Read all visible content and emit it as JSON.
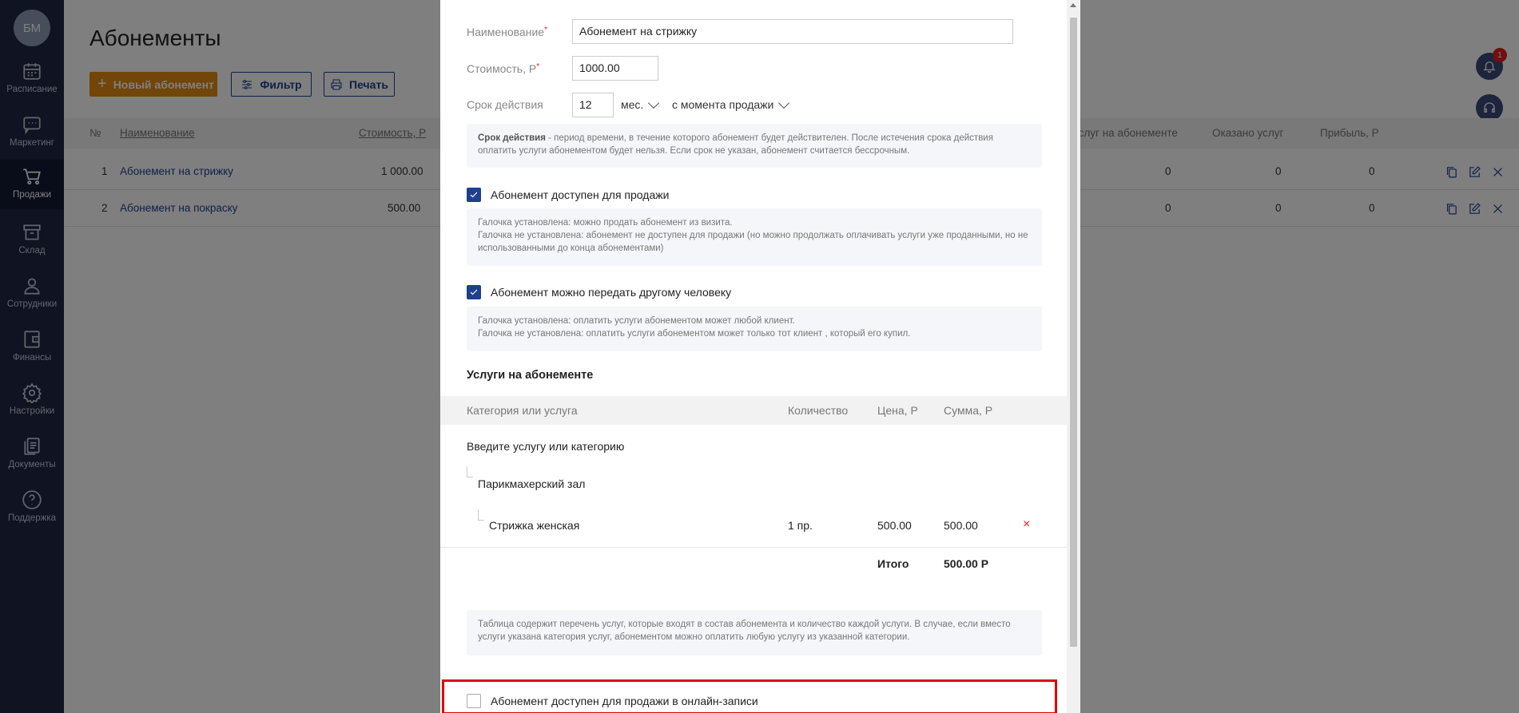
{
  "sidebar": {
    "avatar": "БМ",
    "items": [
      {
        "label": "Расписание",
        "icon": "calendar-icon"
      },
      {
        "label": "Маркетинг",
        "icon": "chat-icon"
      },
      {
        "label": "Продажи",
        "icon": "cart-icon"
      },
      {
        "label": "Склад",
        "icon": "box-icon"
      },
      {
        "label": "Сотрудники",
        "icon": "user-icon"
      },
      {
        "label": "Финансы",
        "icon": "wallet-icon"
      },
      {
        "label": "Настройки",
        "icon": "gear-icon"
      },
      {
        "label": "Документы",
        "icon": "documents-icon"
      },
      {
        "label": "Поддержка",
        "icon": "help-icon"
      }
    ],
    "active": "Продажи"
  },
  "page": {
    "title": "Абонементы",
    "new_button": "Новый абонемент",
    "filter_button": "Фильтр",
    "print_button": "Печать",
    "notification_count": "1"
  },
  "table": {
    "columns": [
      "№",
      "Наименование",
      "Стоимость, Р",
      "Услуг на абонементе",
      "Оказано услуг",
      "Прибыль, Р"
    ],
    "rows": [
      {
        "n": "1",
        "name": "Абонемент на стрижку",
        "price": "1 000.00",
        "services": "0",
        "done": "0",
        "profit": "0"
      },
      {
        "n": "2",
        "name": "Абонемент на покраску",
        "price": "500.00",
        "services": "0",
        "done": "0",
        "profit": "0"
      }
    ]
  },
  "modal": {
    "name_label": "Наименование",
    "name_value": "Абонемент на стрижку",
    "price_label": "Стоимость, Р",
    "price_value": "1000.00",
    "term_label": "Срок действия",
    "term_value": "12",
    "term_unit": "мес.",
    "term_start": "с момента продажи",
    "term_info_bold": "Срок действия",
    "term_info_text": " - период времени, в течение которого абонемент будет действителен. После истечения срока действия оплатить услуги абонементом будет нельзя. Если срок не указан, абонемент считается бессрочным.",
    "sale_checkbox": "Абонемент доступен для продажи",
    "sale_info_1": "Галочка установлена: можно продать абонемент из визита.",
    "sale_info_2": "Галочка не установлена: абонемент не доступен для продажи (но можно продолжать оплачивать услуги уже проданными, но не использованными до конца абонементами)",
    "transfer_checkbox": "Абонемент можно передать другому человеку",
    "transfer_info_1": "Галочка установлена: оплатить услуги абонементом может любой клиент.",
    "transfer_info_2": "Галочка не установлена: оплатить услуги абонементом может только тот клиент , который его купил.",
    "services_title": "Услуги на абонементе",
    "services_columns": [
      "Категория или услуга",
      "Количество",
      "Цена, Р",
      "Сумма, Р"
    ],
    "services_input_placeholder": "Введите услугу или категорию",
    "category": "Парикмахерский зал",
    "service": {
      "name": "Стрижка женская",
      "qty": "1 пр.",
      "price": "500.00",
      "sum": "500.00"
    },
    "total_label": "Итого",
    "total_value": "500.00 Р",
    "services_info": "Таблица содержит перечень услуг, которые входят в состав абонемента и количество каждой услуги. В случае, если вместо услуги указана категория услуг, абонементом можно оплатить любую услугу из указанной категории.",
    "online_checkbox": "Абонемент доступен для продажи в онлайн-записи"
  }
}
